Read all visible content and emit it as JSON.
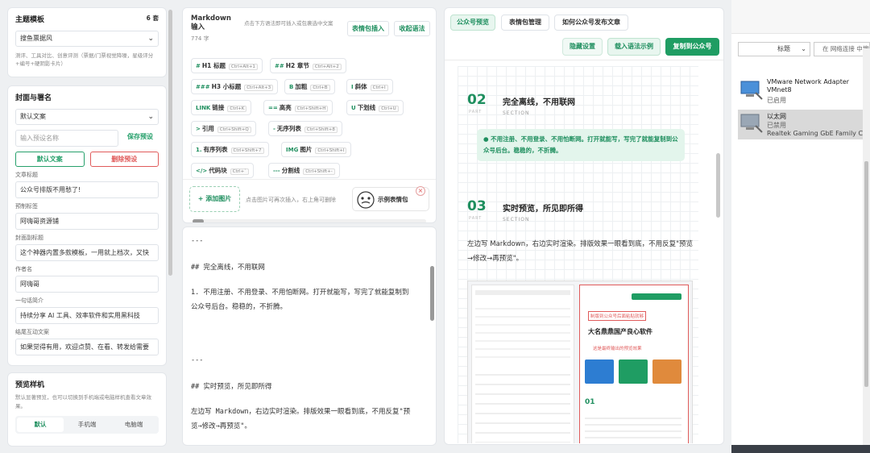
{
  "left": {
    "theme": {
      "title": "主题模板",
      "count": "6 套",
      "selected": "搜鱼票据风",
      "desc": "测评、工具对比、创意评测（票据/门票视觉降噪，星级评分+编号+硬阴影卡片）"
    },
    "cover": {
      "title": "封面与署名",
      "preset_select": "默认文案",
      "preset_name_placeholder": "输入预设名称",
      "save_preset": "保存预设",
      "default_copy": "默认文案",
      "delete_preset": "删除预设",
      "fields": [
        {
          "label": "文章标题",
          "value": "公众号排版不用愁了!"
        },
        {
          "label": "预制标签",
          "value": "阿嗨哥资源铺"
        },
        {
          "label": "封面副标题",
          "value": "这个神器内置多款模板，一用就上档次，又快"
        },
        {
          "label": "作者名",
          "value": "阿嗨哥"
        },
        {
          "label": "一句话简介",
          "value": "持续分享 AI 工具、效率软件和实用黑科技"
        },
        {
          "label": "结尾互动文案",
          "value": "如果觉得有用，欢迎点赞、在看、转发给需要"
        }
      ]
    },
    "preview_style": {
      "title": "预览样机",
      "desc": "默认显著预览，也可以切换到手机端或电脑样机查看文章效果。",
      "tabs": [
        "默认",
        "手机端",
        "电脑端"
      ]
    }
  },
  "editor": {
    "title": "Markdown 输入",
    "word_count": "774 字",
    "hint": "点击下方语法即可插入或包裹选中文案",
    "btn_emoji": "表情包插入",
    "btn_collapse": "收起语法",
    "toolbar": [
      {
        "icon": "#",
        "label": "H1 标题",
        "key": "Ctrl+Alt+1"
      },
      {
        "icon": "##",
        "label": "H2 章节",
        "key": "Ctrl+Alt+2"
      },
      {
        "icon": "###",
        "label": "H3 小标题",
        "key": "Ctrl+Alt+3"
      },
      {
        "icon": "B",
        "label": "加粗",
        "key": "Ctrl+B"
      },
      {
        "icon": "I",
        "label": "斜体",
        "key": "Ctrl+I"
      },
      {
        "icon": "LINK",
        "label": "链接",
        "key": "Ctrl+K"
      },
      {
        "icon": "==",
        "label": "高亮",
        "key": "Ctrl+Shift+H"
      },
      {
        "icon": "U",
        "label": "下划线",
        "key": "Ctrl+U"
      },
      {
        "icon": ">",
        "label": "引用",
        "key": "Ctrl+Shift+Q"
      },
      {
        "icon": "-",
        "label": "无序列表",
        "key": "Ctrl+Shift+8"
      },
      {
        "icon": "1.",
        "label": "有序列表",
        "key": "Ctrl+Shift+7"
      },
      {
        "icon": "IMG",
        "label": "图片",
        "key": "Ctrl+Shift+I"
      },
      {
        "icon": "</>",
        "label": "代码块",
        "key": "Ctrl+`"
      },
      {
        "icon": "---",
        "label": "分割线",
        "key": "Ctrl+Shift+-"
      }
    ],
    "add_image": "+ 添加图片",
    "add_image_hint": "点击图片可再次插入，右上角可删除",
    "sample_emoji": "示例表情包",
    "lines": [
      "---",
      "##  完全离线，不用联网",
      "1. 不用注册、不用登录、不用怕断网。打开就能写，写完了就能复制到",
      "公众号后台。稳稳的，不折腾。",
      "---",
      "## 实时预览，所见即所得",
      "左边写 Markdown，右边实时渲染。排版效果一眼看到底，不用反复\"预",
      "览→修改→再预览\"。"
    ]
  },
  "preview": {
    "tabs": [
      "公众号预览",
      "表情包管理",
      "如何公众号发布文章"
    ],
    "actions": [
      "隐藏设置",
      "载入语法示例",
      "复制到公众号"
    ],
    "sec2": {
      "num": "02",
      "part": "PART",
      "title": "完全离线，不用联网",
      "sub": "SECTION",
      "bullet": "不用注册、不用登录、不用怕断网。打开就能写，写完了就能复制到公众号后台。稳稳的，不折腾。"
    },
    "sec3": {
      "num": "03",
      "part": "PART",
      "title": "实时预览，所见即所得",
      "sub": "SECTION",
      "para": "左边写 Markdown，右边实时渲染。排版效果一眼看到底，不用反复\"预览→修改→再预览\"。"
    },
    "thumb": {
      "title": "大名鼎鼎国产良心软件",
      "callout1": "制版到公众号后面粘贴就够",
      "callout2": "这是最终输出的预览效果"
    }
  },
  "windows": {
    "title_col": "标题",
    "search_placeholder": "在 网络连接 中搜索",
    "adapters": [
      {
        "name": "VMware Network Adapter VMnet8",
        "status": "已启用"
      },
      {
        "name": "以太网",
        "status": "已禁用",
        "device": "Realtek Gaming GbE Family C..."
      }
    ]
  }
}
